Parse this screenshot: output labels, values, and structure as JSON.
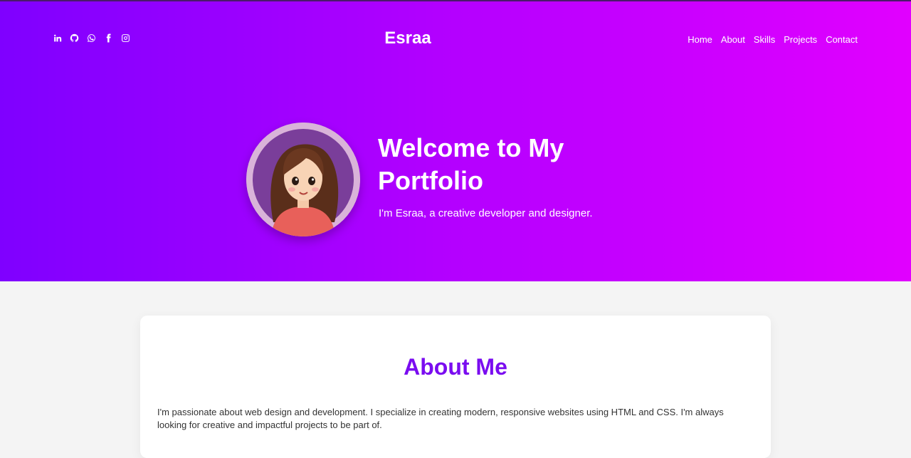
{
  "header": {
    "brand": "Esraa",
    "social": [
      {
        "icon": "linkedin-icon"
      },
      {
        "icon": "github-icon"
      },
      {
        "icon": "whatsapp-icon"
      },
      {
        "icon": "facebook-icon"
      },
      {
        "icon": "instagram-icon"
      }
    ],
    "nav": [
      "Home",
      "About",
      "Skills",
      "Projects",
      "Contact"
    ]
  },
  "hero": {
    "title": "Welcome to My Portfolio",
    "subtitle": "I'm Esraa, a creative developer and designer.",
    "avatar_icon": "avatar-illustration"
  },
  "about": {
    "heading": "About Me",
    "text": "I'm passionate about web design and development. I specialize in creating modern, responsive websites using HTML and CSS. I'm always looking for creative and impactful projects to be part of."
  },
  "colors": {
    "gradient_start": "#7f00ff",
    "gradient_end": "#e100ff",
    "heading_accent": "#7a0cf0",
    "page_background": "#f4f4f4"
  }
}
